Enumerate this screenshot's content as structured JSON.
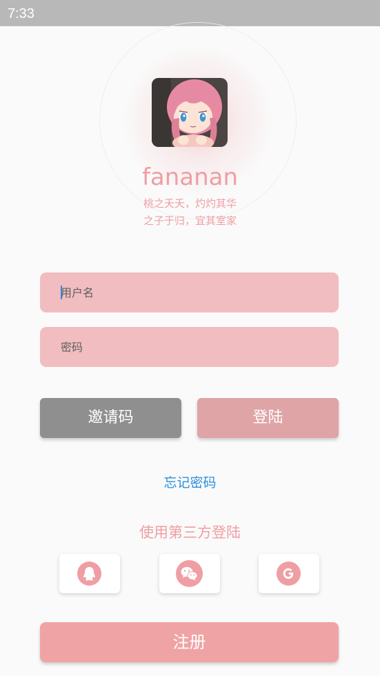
{
  "status_bar": {
    "time": "7:33"
  },
  "profile": {
    "username": "fananan",
    "tagline_line1": "桃之夭夭，灼灼其华",
    "tagline_line2": "之子于归，宜其室家",
    "avatar_icon": "anime-girl-avatar"
  },
  "form": {
    "username_placeholder": "用户名",
    "username_value": "",
    "password_placeholder": "密码",
    "password_value": ""
  },
  "buttons": {
    "invite_label": "邀请码",
    "login_label": "登陆",
    "forgot_label": "忘记密码",
    "register_label": "注册"
  },
  "third_party": {
    "title": "使用第三方登陆",
    "providers": [
      {
        "name": "qq",
        "icon": "qq-icon"
      },
      {
        "name": "wechat",
        "icon": "wechat-icon"
      },
      {
        "name": "google",
        "icon": "google-icon"
      }
    ]
  },
  "colors": {
    "accent_pink": "#ef9ea3",
    "field_bg": "#f2bdc0",
    "invite_bg": "#8f8f8f",
    "login_bg": "#dfa4a6",
    "register_bg": "#efa3a5",
    "link_blue": "#2a8fdc",
    "status_bar_bg": "#b8b8b8"
  }
}
